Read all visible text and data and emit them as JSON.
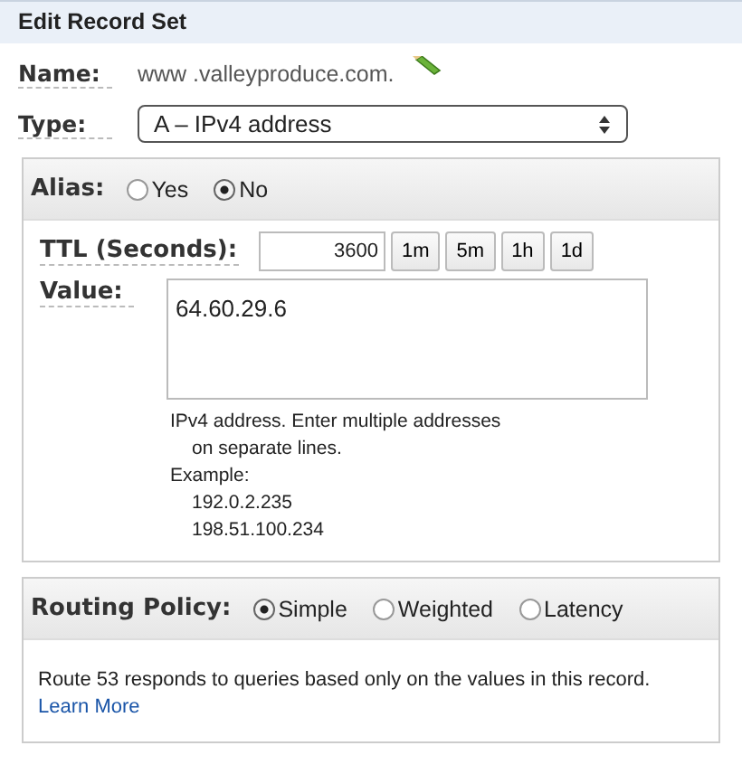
{
  "title": "Edit Record Set",
  "name": {
    "label": "Name:",
    "value": "www .valleyproduce.com."
  },
  "type": {
    "label": "Type:",
    "value": "A – IPv4 address"
  },
  "alias": {
    "label": "Alias:",
    "options": [
      {
        "label": "Yes",
        "selected": false
      },
      {
        "label": "No",
        "selected": true
      }
    ]
  },
  "ttl": {
    "label": "TTL (Seconds):",
    "value": "3600",
    "presets": [
      "1m",
      "5m",
      "1h",
      "1d"
    ]
  },
  "value": {
    "label": "Value:",
    "text": "64.60.29.6",
    "help": "IPv4 address. Enter multiple addresses",
    "help_cont": "on separate lines.",
    "example_label": "Example:",
    "examples": [
      "192.0.2.235",
      "198.51.100.234"
    ]
  },
  "routing": {
    "label": "Routing Policy:",
    "options": [
      {
        "label": "Simple",
        "selected": true
      },
      {
        "label": "Weighted",
        "selected": false
      },
      {
        "label": "Latency",
        "selected": false
      }
    ],
    "description": "Route 53 responds to queries based only on the values in this record.",
    "link": "Learn More"
  }
}
